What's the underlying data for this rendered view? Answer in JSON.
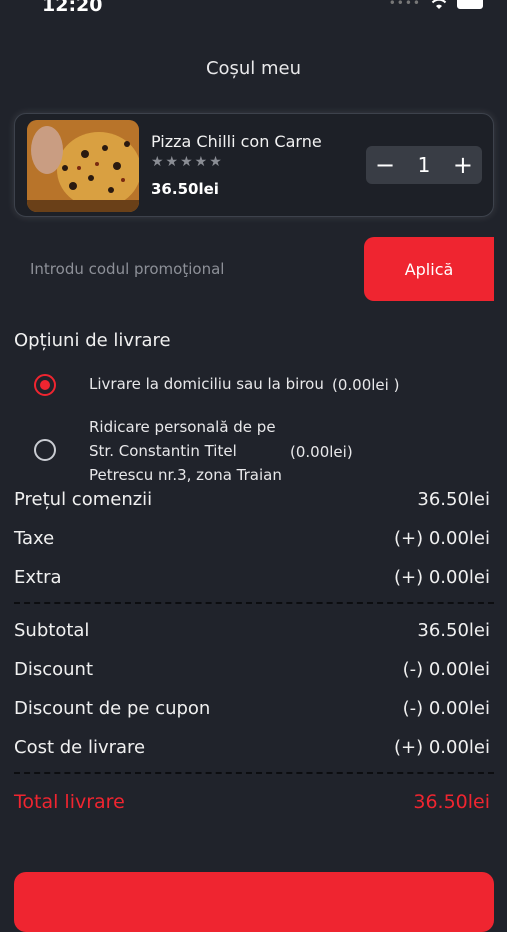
{
  "status_bar": {
    "time": "12:20"
  },
  "header": {
    "title": "Coșul meu"
  },
  "cart_item": {
    "name": "Pizza Chilli con Carne",
    "rating_stars": "★★★★★",
    "price": "36.50lei",
    "quantity": "1",
    "decrement": "−",
    "increment": "+"
  },
  "promo": {
    "placeholder": "Introdu codul promoţional",
    "apply_label": "Aplică"
  },
  "delivery": {
    "title": "Opțiuni de livrare",
    "options": [
      {
        "label": "Livrare la domiciliu sau la birou",
        "price": "(0.00lei )",
        "selected": true
      },
      {
        "label_lines": [
          "Ridicare personală de pe",
          "Str. Constantin Titel",
          "Petrescu nr.3, zona Traian"
        ],
        "price": "(0.00lei)",
        "selected": false
      }
    ]
  },
  "summary": {
    "rows_top": [
      {
        "label": "Prețul comenzii",
        "value": "36.50lei"
      },
      {
        "label": "Taxe",
        "value": "(+) 0.00lei"
      },
      {
        "label": "Extra",
        "value": "(+) 0.00lei"
      }
    ],
    "rows_bottom": [
      {
        "label": "Subtotal",
        "value": "36.50lei"
      },
      {
        "label": "Discount",
        "value": "(-) 0.00lei"
      },
      {
        "label": "Discount de pe cupon",
        "value": "(-) 0.00lei"
      },
      {
        "label": "Cost de livrare",
        "value": "(+) 0.00lei"
      }
    ],
    "total": {
      "label": "Total livrare",
      "value": "36.50lei"
    }
  },
  "colors": {
    "accent": "#ef2530",
    "background": "#20232b"
  },
  "icons": [
    "wifi-icon",
    "battery-icon",
    "minus-icon",
    "plus-icon",
    "radio-selected-icon",
    "radio-unselected-icon"
  ]
}
